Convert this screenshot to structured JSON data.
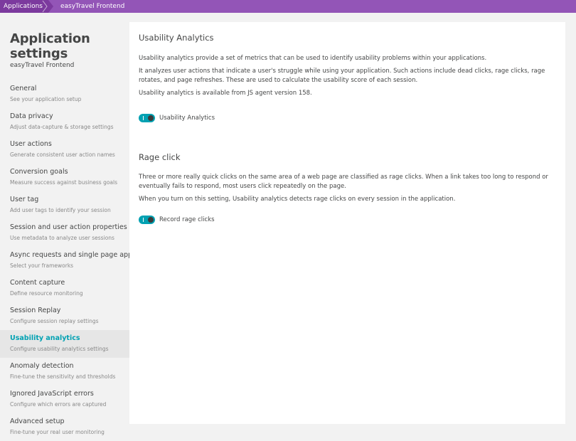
{
  "breadcrumb": {
    "items": [
      {
        "label": "Applications"
      },
      {
        "label": "easyTravel Frontend"
      }
    ]
  },
  "sidebar": {
    "title": "Application settings",
    "subtitle": "easyTravel Frontend",
    "active_index": 9,
    "items": [
      {
        "label": "General",
        "desc": "See your application setup"
      },
      {
        "label": "Data privacy",
        "desc": "Adjust data-capture & storage settings"
      },
      {
        "label": "User actions",
        "desc": "Generate consistent user action names"
      },
      {
        "label": "Conversion goals",
        "desc": "Measure success against business goals"
      },
      {
        "label": "User tag",
        "desc": "Add user tags to identify your session"
      },
      {
        "label": "Session and user action properties",
        "desc": "Use metadata to analyze user sessions"
      },
      {
        "label": "Async requests and single page apps",
        "desc": "Select your frameworks"
      },
      {
        "label": "Content capture",
        "desc": "Define resource monitoring"
      },
      {
        "label": "Session Replay",
        "desc": "Configure session replay settings"
      },
      {
        "label": "Usability analytics",
        "desc": "Configure usability analytics settings"
      },
      {
        "label": "Anomaly detection",
        "desc": "Fine-tune the sensitivity and thresholds"
      },
      {
        "label": "Ignored JavaScript errors",
        "desc": "Configure which errors are captured"
      },
      {
        "label": "Advanced setup",
        "desc": "Fine-tune your real user monitoring"
      }
    ]
  },
  "colors": {
    "brand": "#9355b7",
    "accent": "#00a1b2"
  },
  "main": {
    "usability": {
      "title": "Usability Analytics",
      "p1": "Usability analytics provide a set of metrics that can be used to identify usability problems within your applications.",
      "p2": "It analyzes user actions that indicate a user's struggle while using your application. Such actions include dead clicks, rage clicks, rage rotates, and page refreshes. These are used to calculate the usability score of each session.",
      "p3": "Usability analytics is available from JS agent version 158.",
      "toggle_label": "Usability Analytics",
      "toggle_on": true
    },
    "rage": {
      "title": "Rage click",
      "p1": "Three or more really quick clicks on the same area of a web page are classified as rage clicks. When a link takes too long to respond or eventually fails to respond, most users click repeatedly on the page.",
      "p2": "When you turn on this setting, Usability analytics detects rage clicks on every session in the application.",
      "toggle_label": "Record rage clicks",
      "toggle_on": true
    }
  }
}
